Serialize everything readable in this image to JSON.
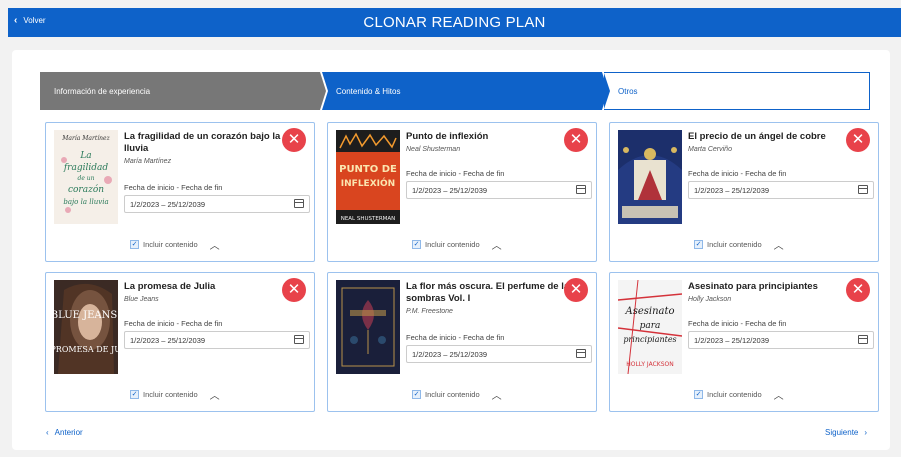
{
  "header": {
    "back_label": "Volver",
    "title": "CLONAR READING PLAN"
  },
  "steps": [
    "Información de experiencia",
    "Contenido & Hitos",
    "Otros"
  ],
  "date_label": "Fecha de inicio - Fecha de fin",
  "include_label": "Incluir contenido",
  "books": [
    {
      "title": "La fragilidad de un corazón bajo la lluvia",
      "author": "María Martínez",
      "dates": "1/2/2023 – 25/12/2039",
      "cover_text": [
        "María Martínez",
        "La fragilidad de un corazón bajo la lluvia"
      ]
    },
    {
      "title": "Punto de inflexión",
      "author": "Neal Shusterman",
      "dates": "1/2/2023 – 25/12/2039",
      "cover_text": [
        "PUNTO DE INFLEXIÓN",
        "NEAL SHUSTERMAN"
      ]
    },
    {
      "title": "El precio de un ángel de cobre",
      "author": "Marta Cerviño",
      "dates": "1/2/2023 – 25/12/2039",
      "cover_text": []
    },
    {
      "title": "La promesa de Julia",
      "author": "Blue Jeans",
      "dates": "1/2/2023 – 25/12/2039",
      "cover_text": [
        "BLUE JEANS",
        "LA PROMESA DE JULIA"
      ]
    },
    {
      "title": "La flor más oscura. El perfume de las sombras Vol. I",
      "author": "P.M. Freestone",
      "dates": "1/2/2023 – 25/12/2039",
      "cover_text": []
    },
    {
      "title": "Asesinato para principiantes",
      "author": "Holly Jackson",
      "dates": "1/2/2023 – 25/12/2039",
      "cover_text": [
        "Asesinato para principiantes",
        "HOLLY JACKSON"
      ]
    }
  ],
  "nav": {
    "prev": "Anterior",
    "next": "Siguiente"
  },
  "colors": {
    "primary": "#0e62c9",
    "danger": "#e8424a",
    "step_done": "#777777"
  }
}
